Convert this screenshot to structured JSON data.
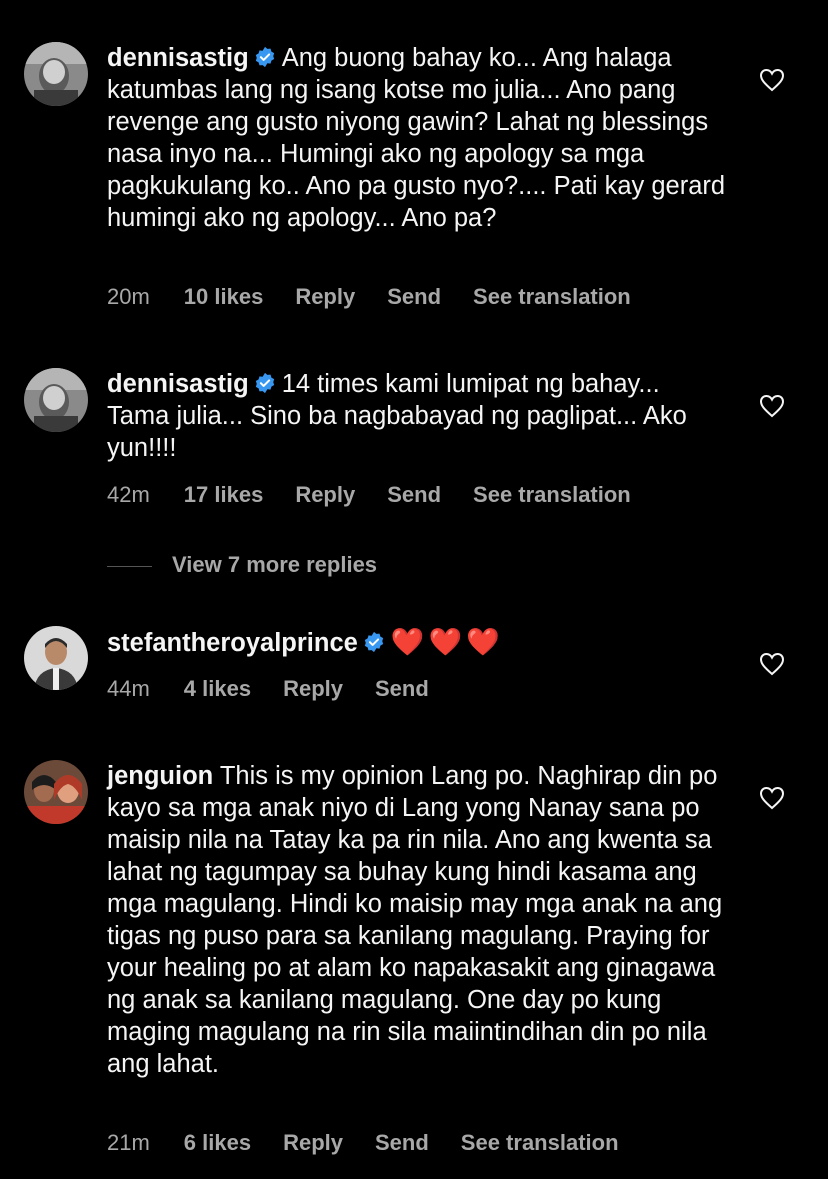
{
  "comments": [
    {
      "username": "dennisastig",
      "text": "Ang buong bahay ko... Ang halaga katumbas lang ng isang kotse mo julia... Ano pang revenge ang gusto niyong gawin? Lahat ng blessings nasa inyo na... Humingi ako ng apology sa mga pagkukulang ko.. Ano pa gusto nyo?.... Pati kay gerard humingi ako ng apology... Ano pa?",
      "time": "20m",
      "likes": "10 likes",
      "reply": "Reply",
      "send": "Send",
      "translate": "See translation"
    },
    {
      "username": "dennisastig",
      "text": "14 times kami lumipat ng bahay... Tama julia... Sino ba nagbabayad ng paglipat... Ako yun!!!!",
      "time": "42m",
      "likes": "17 likes",
      "reply": "Reply",
      "send": "Send",
      "translate": "See translation"
    },
    {
      "username": "stefantheroyalprince",
      "text": "❤️❤️❤️",
      "time": "44m",
      "likes": "4 likes",
      "reply": "Reply",
      "send": "Send"
    },
    {
      "username": "jenguion",
      "text": "This is my opinion Lang po. Naghirap din po kayo sa mga anak niyo di Lang yong Nanay sana po maisip nila na Tatay ka pa rin nila. Ano ang kwenta sa lahat ng tagumpay sa buhay kung hindi kasama ang mga magulang. Hindi ko maisip may mga anak na ang tigas ng puso para sa kanilang magulang. Praying for your healing po at alam ko napakasakit ang ginagawa ng anak sa kanilang magulang. One day po kung maging magulang na rin sila maiintindihan din po nila ang lahat.",
      "time": "21m",
      "likes": "6 likes",
      "reply": "Reply",
      "send": "Send",
      "translate": "See translation"
    }
  ],
  "view_more": "View 7 more replies",
  "colors": {
    "background": "#000000",
    "text": "#f5f5f5",
    "meta": "#a8a8a8",
    "verified": "#3897f0",
    "heart_emoji": "#e53935"
  },
  "icons": {
    "verified": "verified-badge-icon",
    "like": "heart-outline-icon"
  }
}
